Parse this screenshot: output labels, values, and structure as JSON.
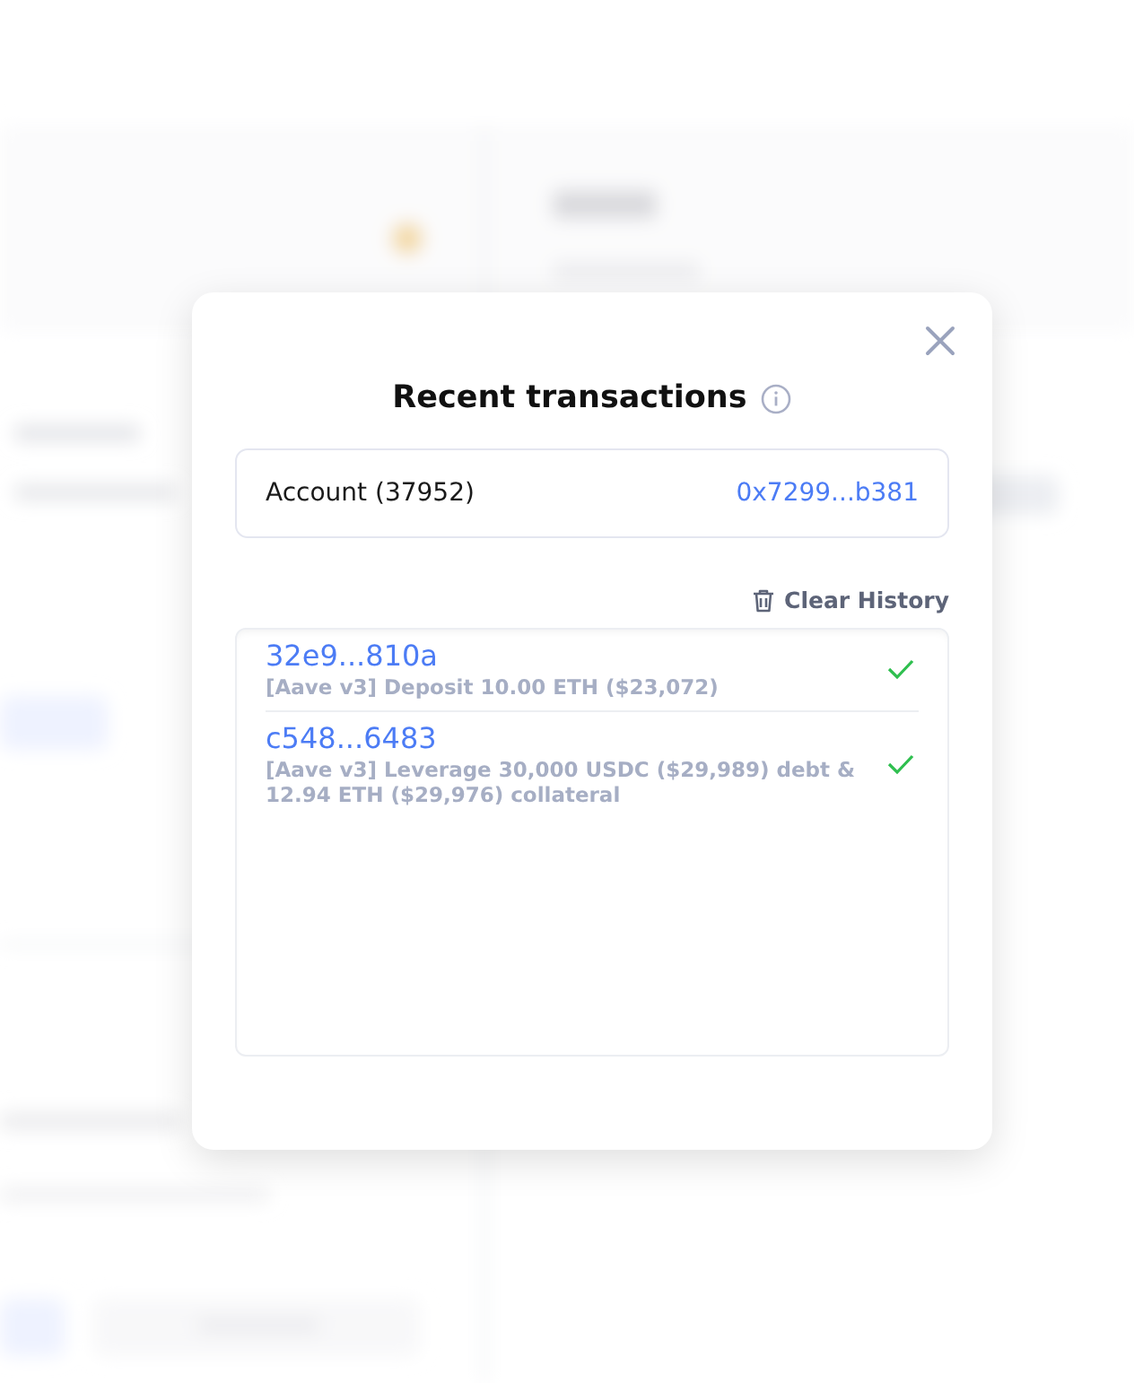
{
  "modal": {
    "title": "Recent transactions",
    "account": {
      "label": "Account (37952)",
      "address": "0x7299...b381"
    },
    "clear_button": "Clear History",
    "transactions": [
      {
        "hash": "32e9...810a",
        "description": "[Aave v3] Deposit 10.00 ETH ($23,072)",
        "succeeded": true
      },
      {
        "hash": "c548...6483",
        "description": "[Aave v3] Leverage 30,000 USDC ($29,989) debt & 12.94 ETH ($29,976) collateral",
        "succeeded": true
      }
    ]
  }
}
